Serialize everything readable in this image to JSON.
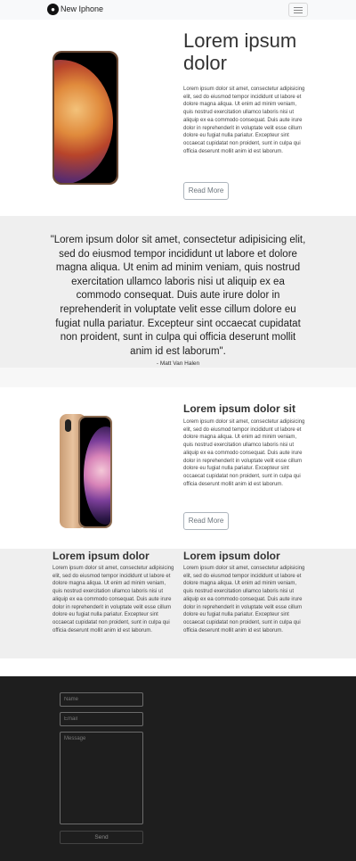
{
  "navbar": {
    "brand": "New Iphone",
    "logo_icon": "apple-icon"
  },
  "hero": {
    "title": "Lorem ipsum dolor",
    "paragraph": "Lorem ipsum dolor sit amet, consectetur adipisicing elit, sed do eiusmod tempor incididunt ut labore et dolore magna aliqua. Ut enim ad minim veniam, quis nostrud exercitation ullamco laboris nisi ut aliquip ex ea commodo consequat. Duis aute irure dolor in reprehenderit in voluptate velit esse cillum dolore eu fugiat nulla pariatur. Excepteur sint occaecat cupidatat non proident, sunt in culpa qui officia deserunt mollit anim id est laborum.",
    "button": "Read More"
  },
  "quote": {
    "text": "\"Lorem ipsum dolor sit amet, consectetur adipisicing elit, sed do eiusmod tempor incididunt ut labore et dolore magna aliqua. Ut enim ad minim veniam, quis nostrud exercitation ullamco laboris nisi ut aliquip ex ea commodo consequat. Duis aute irure dolor in reprehenderit in voluptate velit esse cillum dolore eu fugiat nulla pariatur. Excepteur sint occaecat cupidatat non proident, sunt in culpa qui officia deserunt mollit anim id est laborum\".",
    "author": "- Matt Van Halen"
  },
  "section2": {
    "title": "Lorem ipsum dolor sit",
    "paragraph": "Lorem ipsum dolor sit amet, consectetur adipisicing elit, sed do eiusmod tempor incididunt ut labore et dolore magna aliqua. Ut enim ad minim veniam, quis nostrud exercitation ullamco laboris nisi ut aliquip ex ea commodo consequat. Duis aute irure dolor in reprehenderit in voluptate velit esse cillum dolore eu fugiat nulla pariatur. Excepteur sint occaecat cupidatat non proident, sunt in culpa qui officia deserunt mollit anim id est laborum.",
    "button": "Read More"
  },
  "columns": [
    {
      "title": "Lorem ipsum dolor",
      "paragraph": "Lorem ipsum dolor sit amet, consectetur adipisicing elit, sed do eiusmod tempor incididunt ut labore et dolore magna aliqua. Ut enim ad minim veniam, quis nostrud exercitation ullamco laboris nisi ut aliquip ex ea commodo consequat. Duis aute irure dolor in reprehenderit in voluptate velit esse cillum dolore eu fugiat nulla pariatur. Excepteur sint occaecat cupidatat non proident, sunt in culpa qui officia deserunt mollit anim id est laborum."
    },
    {
      "title": "Lorem ipsum dolor",
      "paragraph": "Lorem ipsum dolor sit amet, consectetur adipisicing elit, sed do eiusmod tempor incididunt ut labore et dolore magna aliqua. Ut enim ad minim veniam, quis nostrud exercitation ullamco laboris nisi ut aliquip ex ea commodo consequat. Duis aute irure dolor in reprehenderit in voluptate velit esse cillum dolore eu fugiat nulla pariatur. Excepteur sint occaecat cupidatat non proident, sunt in culpa qui officia deserunt mollit anim id est laborum."
    }
  ],
  "contact_form": {
    "name_placeholder": "Name",
    "email_placeholder": "Email",
    "message_placeholder": "Message",
    "send_label": "Send"
  },
  "colors": {
    "band_gray": "#efefef",
    "footer_dark": "#1e1e1e",
    "navbar_bg": "#f8f9fa"
  }
}
